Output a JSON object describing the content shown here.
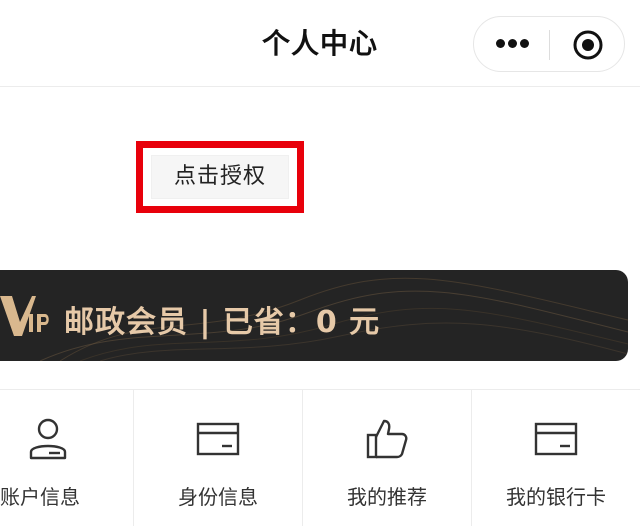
{
  "navbar": {
    "title": "个人中心",
    "capsule_icons": [
      "more-icon",
      "close-circle-icon"
    ]
  },
  "auth": {
    "button_label": "点击授权",
    "highlight_color": "#e8000b"
  },
  "vip": {
    "badge_letters": "VIP",
    "text": "邮政会员 | 已省：0 元",
    "background_color": "#242424",
    "text_color": "#e6c9a8"
  },
  "menu": {
    "items": [
      {
        "label": "账户信息",
        "icon": "person-icon"
      },
      {
        "label": "身份信息",
        "icon": "id-card-icon"
      },
      {
        "label": "我的推荐",
        "icon": "thumbs-up-icon"
      },
      {
        "label": "我的银行卡",
        "icon": "bank-card-icon"
      }
    ]
  }
}
